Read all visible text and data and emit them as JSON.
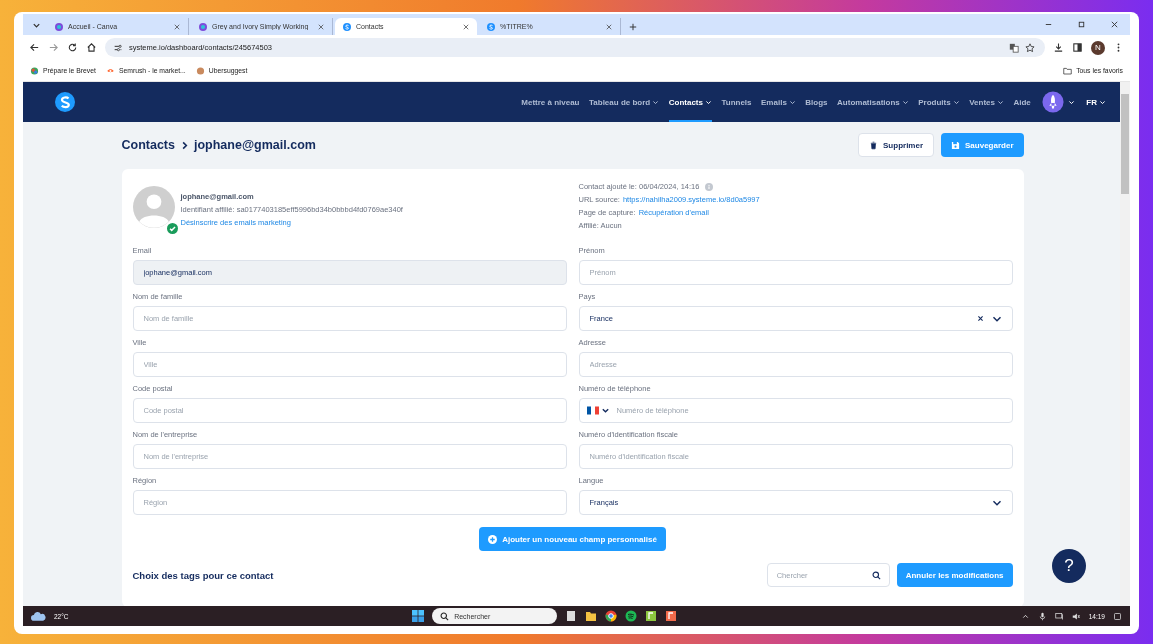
{
  "browser": {
    "tabs": [
      {
        "title": "Accueil - Canva",
        "selected": false
      },
      {
        "title": "Grey and Ivory Simply Working",
        "selected": false
      },
      {
        "title": "Contacts",
        "selected": true
      },
      {
        "title": "%TITRE%",
        "selected": false
      }
    ],
    "url": "systeme.io/dashboard/contacts/245674503",
    "profile_initial": "N",
    "bookmarks": [
      {
        "label": "Prépare le Brevet"
      },
      {
        "label": "Semrush - le market..."
      },
      {
        "label": "Ubersuggest"
      }
    ],
    "all_bookmarks": "Tous les favoris"
  },
  "nav": {
    "items": [
      {
        "label": "Mettre à niveau",
        "dropdown": false,
        "selected": false
      },
      {
        "label": "Tableau de bord",
        "dropdown": true,
        "selected": false
      },
      {
        "label": "Contacts",
        "dropdown": true,
        "selected": true
      },
      {
        "label": "Tunnels",
        "dropdown": false,
        "selected": false
      },
      {
        "label": "Emails",
        "dropdown": true,
        "selected": false
      },
      {
        "label": "Blogs",
        "dropdown": false,
        "selected": false
      },
      {
        "label": "Automatisations",
        "dropdown": true,
        "selected": false
      },
      {
        "label": "Produits",
        "dropdown": true,
        "selected": false
      },
      {
        "label": "Ventes",
        "dropdown": true,
        "selected": false
      },
      {
        "label": "Aide",
        "dropdown": false,
        "selected": false
      }
    ],
    "language": "FR"
  },
  "header": {
    "breadcrumb_root": "Contacts",
    "breadcrumb_current": "jophane@gmail.com",
    "delete_button": "Supprimer",
    "save_button": "Sauvegarder"
  },
  "contact": {
    "email": "jophane@gmail.com",
    "affiliate_id": "Identifiant affilié: sa0177403185eff5996bd34b0bbbd4fd0769ae340f",
    "unsubscribe_link": "Désinscrire des emails marketing",
    "verified": true
  },
  "meta": [
    {
      "label": "Contact ajouté le:",
      "value": "06/04/2024, 14:16",
      "kind": "text",
      "info": true
    },
    {
      "label": "URL source:",
      "value": "https://nahilha2009.systeme.io/8d0a5997",
      "kind": "link",
      "info": false
    },
    {
      "label": "Page de capture:",
      "value": "Récupération d'email",
      "kind": "link",
      "info": false
    },
    {
      "label": "Affilié:",
      "value": "Aucun",
      "kind": "text",
      "info": false
    }
  ],
  "fields": [
    {
      "label": "Email",
      "kind": "input",
      "value": "jophane@gmail.com",
      "disabled": true
    },
    {
      "label": "Prénom",
      "kind": "input",
      "placeholder": "Prénom",
      "disabled": false
    },
    {
      "label": "Nom de famille",
      "kind": "input",
      "placeholder": "Nom de famille",
      "disabled": false
    },
    {
      "label": "Pays",
      "kind": "select",
      "value": "France",
      "clearable": true,
      "disabled": false
    },
    {
      "label": "Ville",
      "kind": "input",
      "placeholder": "Ville",
      "disabled": false
    },
    {
      "label": "Adresse",
      "kind": "input",
      "placeholder": "Adresse",
      "disabled": false
    },
    {
      "label": "Code postal",
      "kind": "input",
      "placeholder": "Code postal",
      "disabled": false
    },
    {
      "label": "Numéro de téléphone",
      "kind": "phone",
      "placeholder": "Numéro de téléphone",
      "disabled": false
    },
    {
      "label": "Nom de l'entreprise",
      "kind": "input",
      "placeholder": "Nom de l'entreprise",
      "disabled": false
    },
    {
      "label": "Numéro d'identification fiscale",
      "kind": "input",
      "placeholder": "Numéro d'identification fiscale",
      "disabled": false
    },
    {
      "label": "Région",
      "kind": "input",
      "placeholder": "Région",
      "disabled": false
    },
    {
      "label": "Langue",
      "kind": "select",
      "value": "Français",
      "clearable": false,
      "disabled": false
    }
  ],
  "add_field_button": "Ajouter un nouveau champ personnalisé",
  "tags": {
    "title": "Choix des tags pour ce contact",
    "search_placeholder": "Chercher",
    "cancel_button": "Annuler les modifications"
  },
  "help_button": "?",
  "taskbar": {
    "temperature": "22°C",
    "search_placeholder": "Rechercher",
    "time": "14:19"
  }
}
